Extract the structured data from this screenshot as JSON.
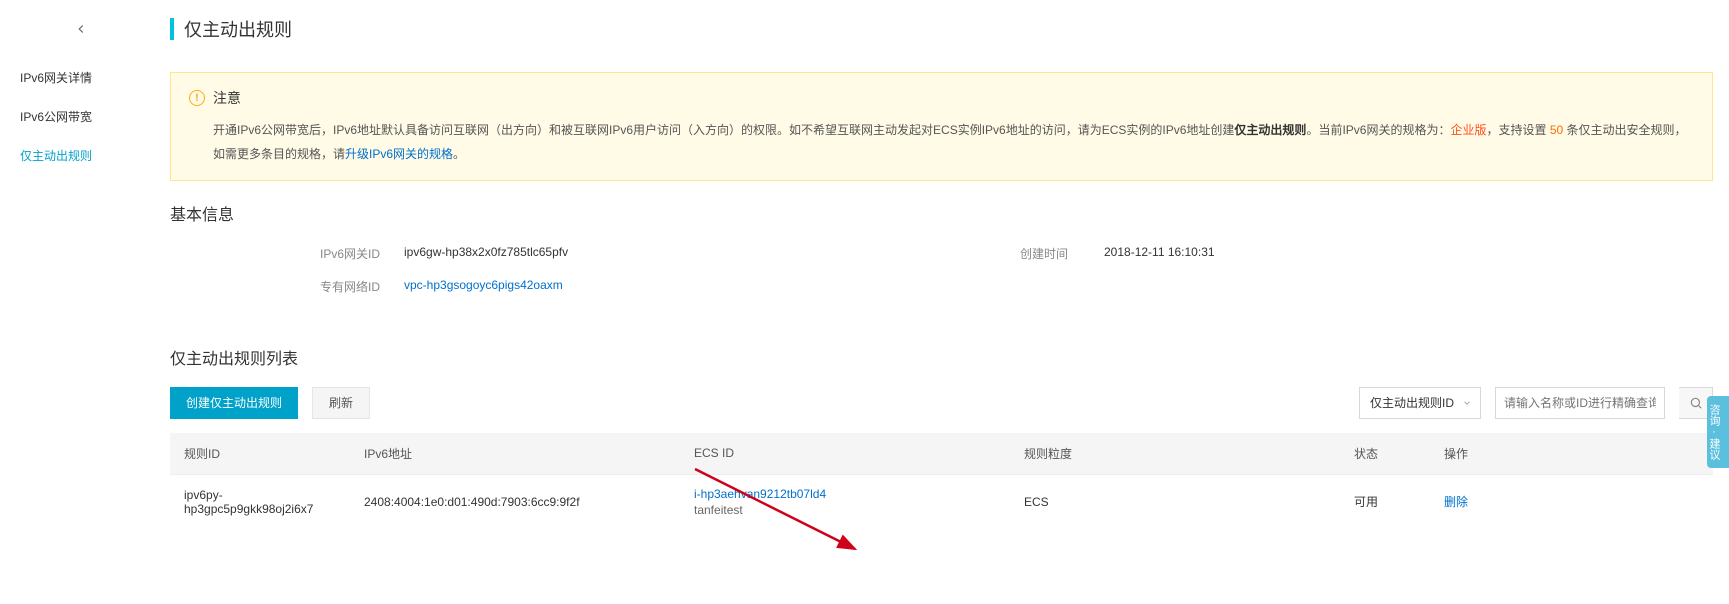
{
  "sidebar": {
    "items": [
      {
        "label": "IPv6网关详情"
      },
      {
        "label": "IPv6公网带宽"
      },
      {
        "label": "仅主动出规则"
      }
    ]
  },
  "page_title": "仅主动出规则",
  "alert": {
    "title": "注意",
    "body_p1": "开通IPv6公网带宽后，IPv6地址默认具备访问互联网（出方向）和被互联网IPv6用户访问（入方向）的权限。如不希望互联网主动发起对ECS实例IPv6地址的访问，请为ECS实例的IPv6地址创建",
    "body_bold": "仅主动出规则",
    "body_p2": "。当前IPv6网关的规格为：",
    "body_spec": "企业版",
    "body_p3": "，支持设置 ",
    "body_count": "50",
    "body_p4": " 条仅主动出安全规则，如需更多条目的规格，请",
    "body_link": "升级IPv6网关的规格",
    "body_p5": "。"
  },
  "sections": {
    "basic_title": "基本信息",
    "list_title": "仅主动出规则列表"
  },
  "info": {
    "gw_id_label": "IPv6网关ID",
    "gw_id_value": "ipv6gw-hp38x2x0fz785tlc65pfv",
    "create_time_label": "创建时间",
    "create_time_value": "2018-12-11 16:10:31",
    "vpc_id_label": "专有网络ID",
    "vpc_id_value": "vpc-hp3gsogoyc6pigs42oaxm"
  },
  "toolbar": {
    "create_label": "创建仅主动出规则",
    "refresh_label": "刷新",
    "filter_field": "仅主动出规则ID",
    "search_placeholder": "请输入名称或ID进行精确查询"
  },
  "table": {
    "headers": {
      "rule_id": "规则ID",
      "ipv6_addr": "IPv6地址",
      "ecs_id": "ECS ID",
      "granularity": "规则粒度",
      "status": "状态",
      "ops": "操作"
    },
    "rows": [
      {
        "rule_id": "ipv6py-hp3gpc5p9gkk98oj2i6x7",
        "ipv6_addr": "2408:4004:1e0:d01:490d:7903:6cc9:9f2f",
        "ecs_id": "i-hp3aehvan9212tb07ld4",
        "ecs_name": "tanfeitest",
        "granularity": "ECS",
        "status": "可用",
        "op": "删除"
      }
    ]
  },
  "float_tab": "咨询·建议"
}
